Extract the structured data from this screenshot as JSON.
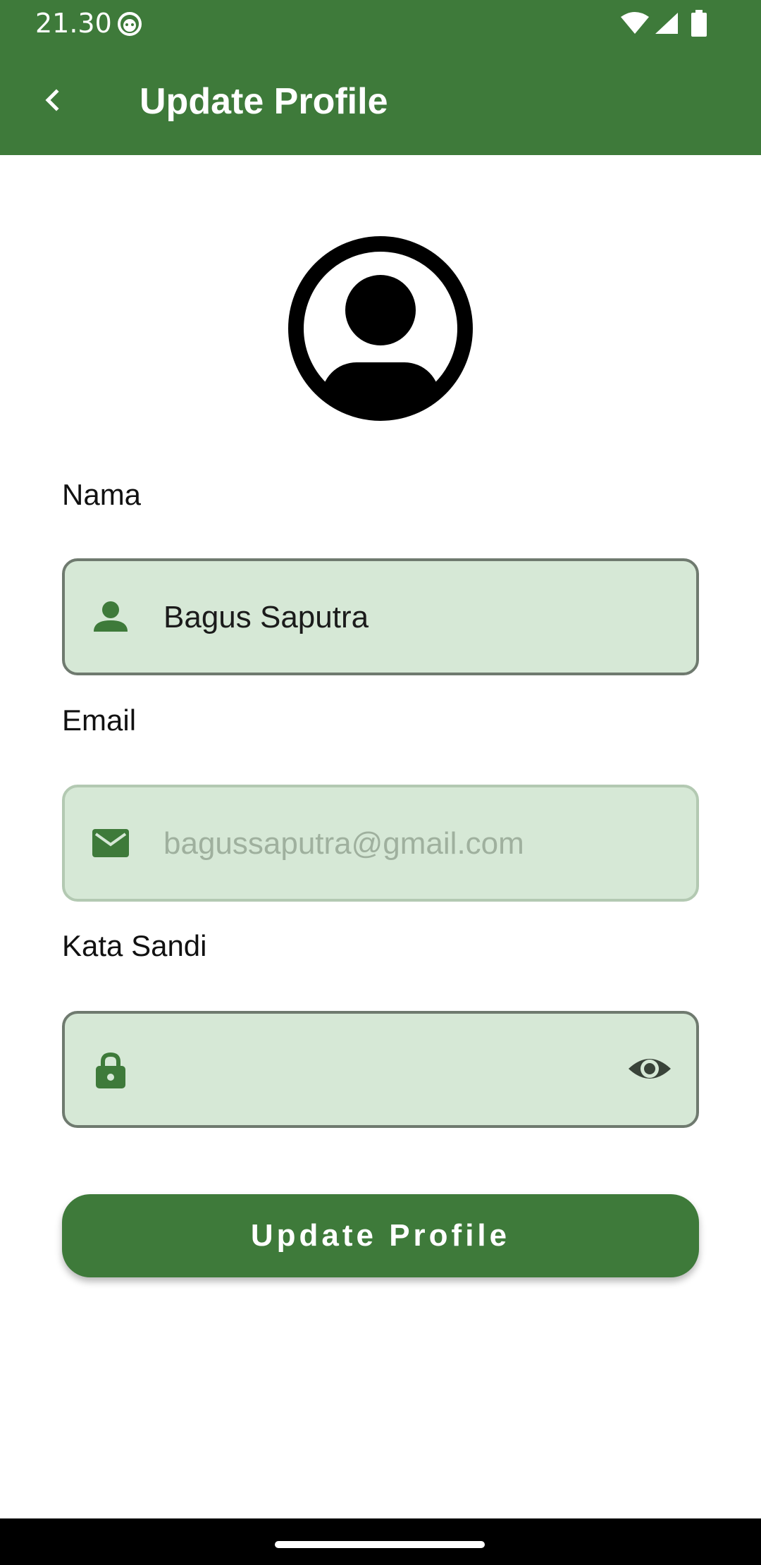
{
  "status_bar": {
    "time": "21.30",
    "app_icon": "android-face-icon",
    "wifi_icon": "wifi-icon",
    "signal_icon": "signal-icon",
    "battery_icon": "battery-icon"
  },
  "app_bar": {
    "back_icon": "chevron-left-icon",
    "title": "Update Profile",
    "background_color": "#3e7a3a"
  },
  "avatar": {
    "icon": "account-circle-icon"
  },
  "form": {
    "name": {
      "label": "Nama",
      "icon": "person-icon",
      "value": "Bagus Saputra"
    },
    "email": {
      "label": "Email",
      "icon": "mail-icon",
      "value": "bagussaputra@gmail.com",
      "disabled": true
    },
    "password": {
      "label": "Kata Sandi",
      "icon": "lock-icon",
      "value": "",
      "toggle_icon": "eye-icon"
    },
    "submit_label": "Update Profile"
  },
  "colors": {
    "primary": "#3e7a3a",
    "field_fill": "#d6e8d6",
    "field_border": "#6f7a6f"
  }
}
